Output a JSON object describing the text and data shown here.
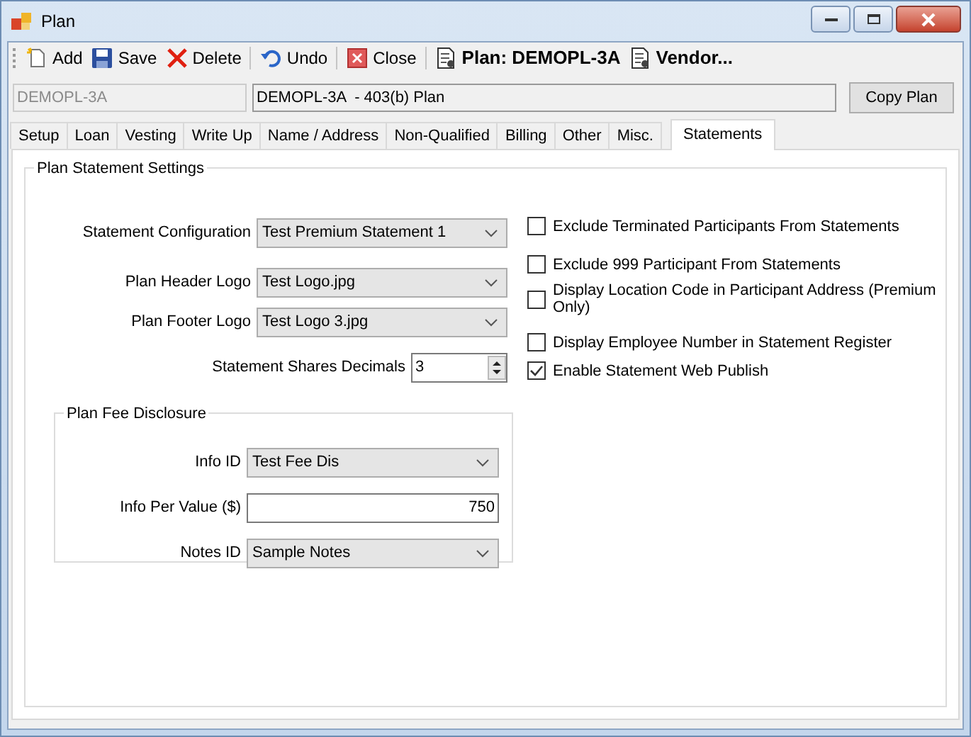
{
  "window": {
    "title": "Plan"
  },
  "toolbar": [
    {
      "kind": "button",
      "label": "Add"
    },
    {
      "kind": "button",
      "label": "Save"
    },
    {
      "kind": "button",
      "label": "Delete"
    },
    {
      "kind": "separator"
    },
    {
      "kind": "button",
      "label": "Undo"
    },
    {
      "kind": "separator"
    },
    {
      "kind": "button",
      "label": "Close"
    },
    {
      "kind": "separator"
    },
    {
      "kind": "link",
      "label": "Plan: DEMOPL-3A"
    },
    {
      "kind": "link",
      "label": "Vendor..."
    }
  ],
  "plan_code": {
    "value": "DEMOPL-3A",
    "disabled": true
  },
  "plan_name": {
    "value": "DEMOPL-3A  - 403(b) Plan"
  },
  "copy_button": "Copy Plan",
  "tabs": [
    {
      "label": "Setup",
      "selected": false
    },
    {
      "label": "Loan",
      "selected": false
    },
    {
      "label": "Vesting",
      "selected": false
    },
    {
      "label": "Write Up",
      "selected": false
    },
    {
      "label": "Name / Address",
      "selected": false
    },
    {
      "label": "Non-Qualified",
      "selected": false
    },
    {
      "label": "Billing",
      "selected": false
    },
    {
      "label": "Other",
      "selected": false
    },
    {
      "label": "Misc.",
      "selected": false
    },
    {
      "label": "Statements",
      "selected": true
    }
  ],
  "settings": {
    "title": "Plan Statement Settings",
    "fields": [
      {
        "kind": "combo",
        "label": "Statement Configuration",
        "value": "Test Premium Statement 1"
      },
      {
        "kind": "combo",
        "label": "Plan Header Logo",
        "value": "Test Logo.jpg"
      },
      {
        "kind": "combo",
        "label": "Plan Footer Logo",
        "value": "Test Logo 3.jpg"
      },
      {
        "kind": "spinner",
        "label": "Statement Shares Decimals",
        "value": "3"
      }
    ],
    "fee_disclosure": {
      "title": "Plan Fee Disclosure",
      "fields": [
        {
          "kind": "combo",
          "label": "Info ID",
          "value": "Test Fee Dis"
        },
        {
          "kind": "text",
          "label": "Info Per Value ($)",
          "value": "750"
        },
        {
          "kind": "combo",
          "label": "Notes ID",
          "value": "Sample Notes"
        }
      ]
    },
    "options": [
      {
        "label": "Exclude Terminated Participants From Statements",
        "checked": false
      },
      {
        "label": "Exclude 999 Participant From Statements",
        "checked": false
      },
      {
        "label": "Display Location Code in Participant Address (Premium Only)",
        "checked": false
      },
      {
        "label": "Display Employee Number in Statement Register",
        "checked": false
      },
      {
        "label": "Enable Statement Web Publish",
        "checked": true
      }
    ]
  }
}
